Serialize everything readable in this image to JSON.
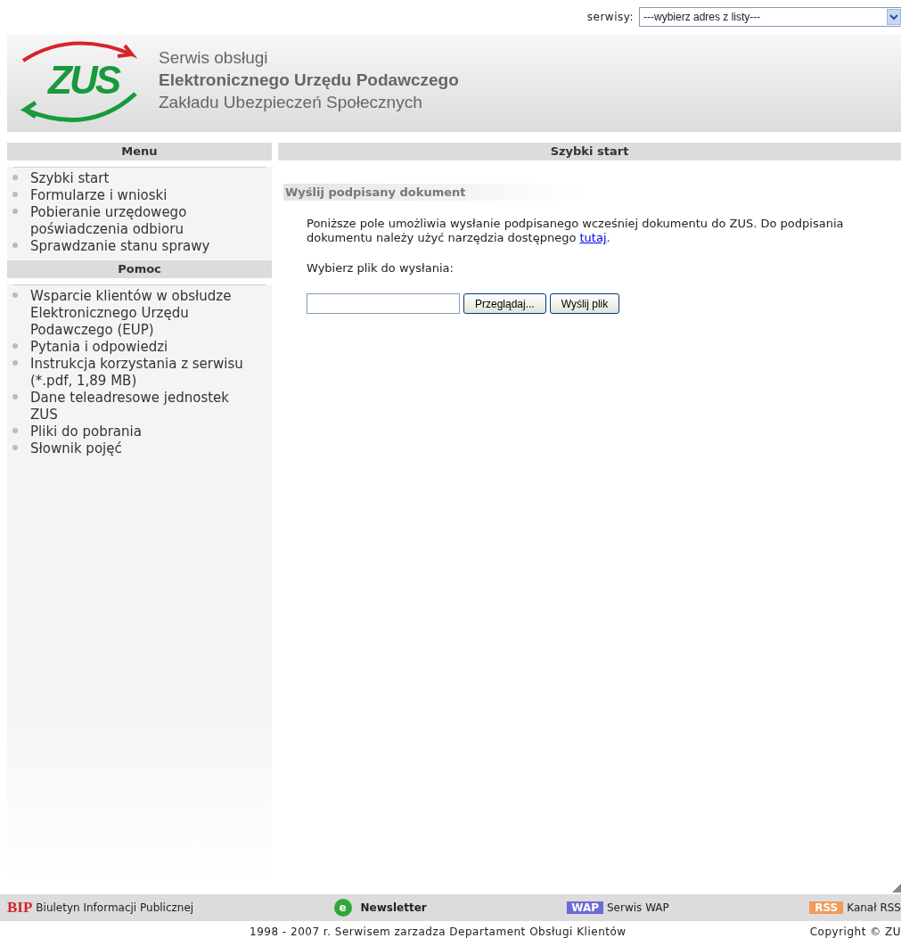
{
  "top_bar": {
    "label": "serwisy:",
    "select": {
      "value": "---wybierz adres z listy---"
    }
  },
  "header": {
    "logo_text": "ZUS",
    "lines": [
      "Serwis obsługi",
      "Elektronicznego Urzędu Podawczego",
      "Zakładu Ubezpieczeń Społecznych"
    ]
  },
  "sidebar": {
    "sections": [
      {
        "title": "Menu",
        "items": [
          "Szybki start",
          "Formularze i wnioski",
          "Pobieranie urzędowego poświadczenia odbioru",
          "Sprawdzanie stanu sprawy"
        ]
      },
      {
        "title": "Pomoc",
        "items": [
          "Wsparcie klientów w obsłudze Elektronicznego Urzędu Podawczego (EUP)",
          "Pytania i odpowiedzi",
          "Instrukcja korzystania z serwisu (*.pdf, 1,89 MB)",
          "Dane teleadresowe jednostek ZUS",
          "Pliki do pobrania",
          "Słownik pojęć"
        ]
      }
    ]
  },
  "main": {
    "title": "Szybki start",
    "section_title": "Wyślij podpisany dokument",
    "paragraph": "Poniższe pole umożliwia wysłanie podpisanego wcześniej dokumentu do ZUS. Do podpisania dokumentu należy użyć narzędzia dostępnego ",
    "link": "tutaj",
    "after_link": ".",
    "file_label": "Wybierz plik do wysłania:",
    "browse_button": "Przeglądaj...",
    "send_button": "Wyślij plik"
  },
  "footer": {
    "links": [
      {
        "kind": "bip",
        "badge": "BIP",
        "label": "Biuletyn Informacji Publicznej"
      },
      {
        "kind": "newsletter",
        "badge": "e",
        "label": "Newsletter"
      },
      {
        "kind": "wap",
        "badge": "WAP",
        "label": "Serwis WAP"
      },
      {
        "kind": "rss",
        "badge": "RSS",
        "label": "Kanał RSS"
      }
    ],
    "credit": "1998 - 2007 r. Serwisem zarzadza Departament Obsługi Klientów",
    "copyright": "Copyright © ZU"
  }
}
